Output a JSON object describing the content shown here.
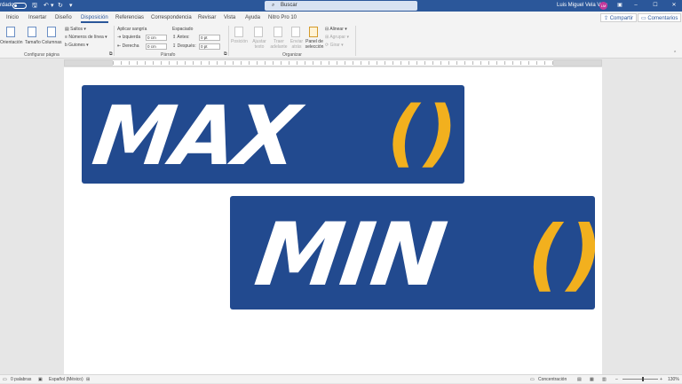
{
  "titlebar": {
    "autosave_label": "rdado",
    "doc_title": "Documento1 - Word",
    "search_placeholder": "Buscar",
    "user_name": "Luis Miguel Vela Vela",
    "avatar_initials": "LM"
  },
  "tabs": [
    {
      "label": "Inicio"
    },
    {
      "label": "Insertar"
    },
    {
      "label": "Diseño"
    },
    {
      "label": "Disposición"
    },
    {
      "label": "Referencias"
    },
    {
      "label": "Correspondencia"
    },
    {
      "label": "Revisar"
    },
    {
      "label": "Vista"
    },
    {
      "label": "Ayuda"
    },
    {
      "label": "Nitro Pro 10"
    }
  ],
  "share_label": "Compartir",
  "comments_label": "Comentarios",
  "ribbon": {
    "page_setup": {
      "orientation": "Orientación",
      "size": "Tamaño",
      "columns": "Columnas",
      "breaks": "Saltos",
      "line_numbers": "Números de línea",
      "hyphenation": "Guiones",
      "group_label": "Configurar página"
    },
    "paragraph": {
      "indent_title": "Aplicar sangría",
      "spacing_title": "Espaciado",
      "left_label": "Izquierda",
      "left_value": "0 cm",
      "right_label": "Derecha",
      "right_value": "0 cm",
      "before_label": "Antes:",
      "before_value": "0 pt",
      "after_label": "Después:",
      "after_value": "0 pt",
      "group_label": "Párrafo"
    },
    "arrange": {
      "position": "Posición",
      "wrap_text": "Ajustar texto",
      "bring_forward": "Traer adelante",
      "send_backward": "Enviar atrás",
      "selection_pane": "Panel de selección",
      "align": "Alinear",
      "group": "Agrupar",
      "rotate": "Girar",
      "group_label": "Organizar"
    }
  },
  "document": {
    "banner1_word": "MAX",
    "banner1_parens": "()",
    "banner2_word": "MIN",
    "banner2_parens": "()"
  },
  "statusbar": {
    "words": "0 palabras",
    "language": "Español (México)",
    "focus": "Concentración",
    "zoom": "130%"
  },
  "colors": {
    "accent": "#2b579a",
    "banner_bg": "#224a8f",
    "parens": "#f2b01e"
  }
}
